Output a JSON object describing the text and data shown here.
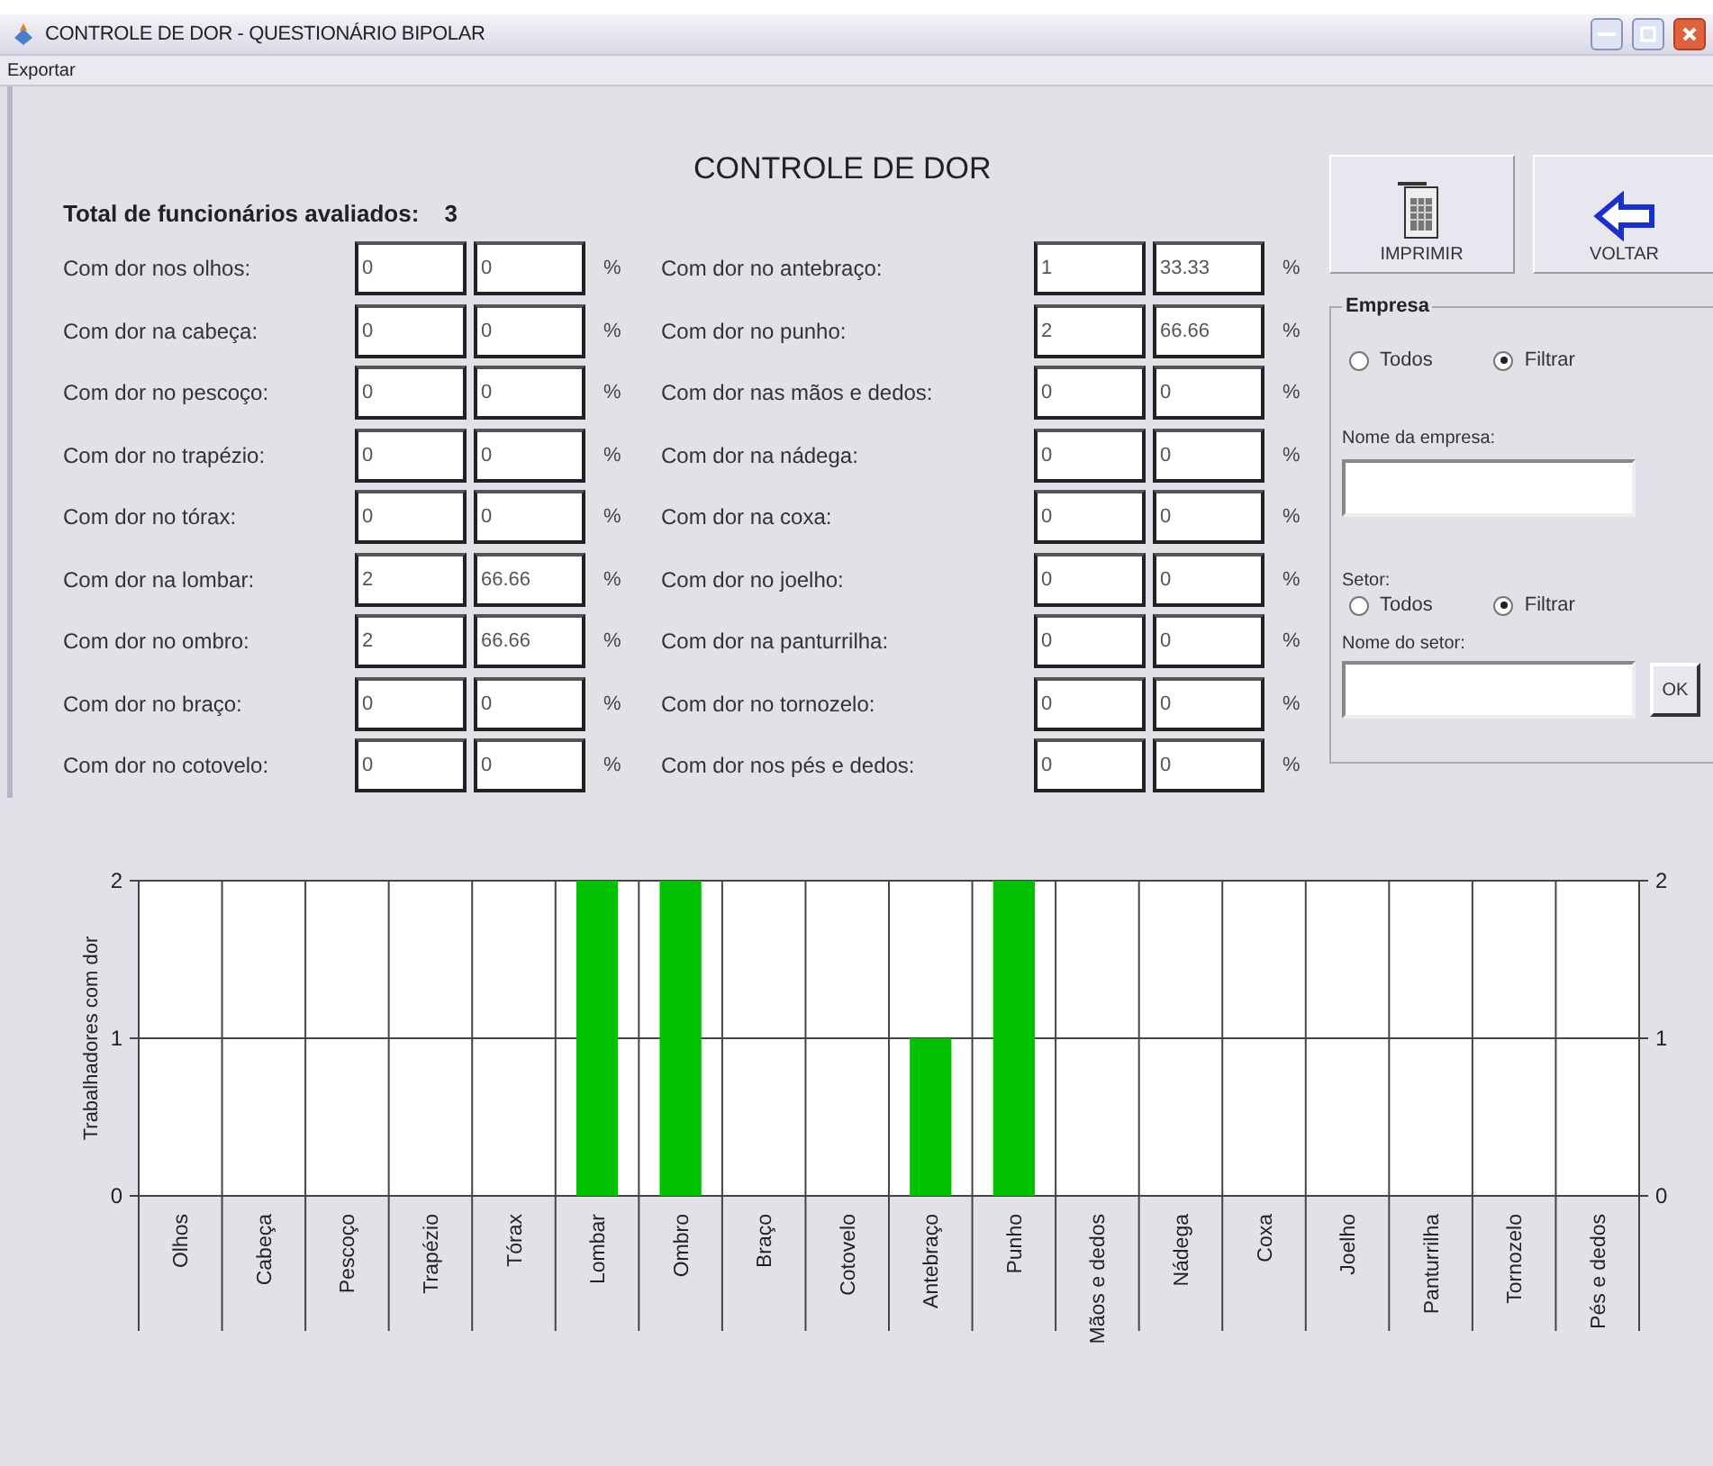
{
  "window": {
    "title": "CONTROLE DE DOR - QUESTIONÁRIO BIPOLAR"
  },
  "menu": [
    {
      "label": "Exportar"
    }
  ],
  "heading": "CONTROLE DE DOR",
  "total": {
    "label": "Total de funcionários avaliados:",
    "value": "3"
  },
  "field_columns": [
    {
      "rows": [
        {
          "label": "Com dor nos olhos:",
          "count": "0",
          "percent": "0",
          "unit": "%"
        },
        {
          "label": "Com dor na cabeça:",
          "count": "0",
          "percent": "0",
          "unit": "%"
        },
        {
          "label": "Com dor no pescoço:",
          "count": "0",
          "percent": "0",
          "unit": "%"
        },
        {
          "label": "Com dor no trapézio:",
          "count": "0",
          "percent": "0",
          "unit": "%"
        },
        {
          "label": "Com dor no tórax:",
          "count": "0",
          "percent": "0",
          "unit": "%"
        },
        {
          "label": "Com dor na lombar:",
          "count": "2",
          "percent": "66.66",
          "unit": "%"
        },
        {
          "label": "Com dor no ombro:",
          "count": "2",
          "percent": "66.66",
          "unit": "%"
        },
        {
          "label": "Com dor no braço:",
          "count": "0",
          "percent": "0",
          "unit": "%"
        },
        {
          "label": "Com dor no cotovelo:",
          "count": "0",
          "percent": "0",
          "unit": "%"
        }
      ]
    },
    {
      "rows": [
        {
          "label": "Com dor no antebraço:",
          "count": "1",
          "percent": "33.33",
          "unit": "%"
        },
        {
          "label": "Com dor no punho:",
          "count": "2",
          "percent": "66.66",
          "unit": "%"
        },
        {
          "label": "Com dor nas mãos e dedos:",
          "count": "0",
          "percent": "0",
          "unit": "%"
        },
        {
          "label": "Com dor na nádega:",
          "count": "0",
          "percent": "0",
          "unit": "%"
        },
        {
          "label": "Com dor na coxa:",
          "count": "0",
          "percent": "0",
          "unit": "%"
        },
        {
          "label": "Com dor no joelho:",
          "count": "0",
          "percent": "0",
          "unit": "%"
        },
        {
          "label": "Com dor na panturrilha:",
          "count": "0",
          "percent": "0",
          "unit": "%"
        },
        {
          "label": "Com dor no tornozelo:",
          "count": "0",
          "percent": "0",
          "unit": "%"
        },
        {
          "label": "Com dor nos pés e dedos:",
          "count": "0",
          "percent": "0",
          "unit": "%"
        }
      ]
    }
  ],
  "buttons": [
    {
      "label": "IMPRIMIR",
      "kind": "print"
    },
    {
      "label": "VOLTAR",
      "kind": "back"
    }
  ],
  "filter": {
    "title": "Empresa",
    "empresa": {
      "options": [
        {
          "label": "Todos",
          "selected": false
        },
        {
          "label": "Filtrar",
          "selected": true
        }
      ],
      "name_label": "Nome da empresa:"
    },
    "setor": {
      "title": "Setor:",
      "options": [
        {
          "label": "Todos",
          "selected": false
        },
        {
          "label": "Filtrar",
          "selected": true
        }
      ],
      "name_label": "Nome do setor:"
    },
    "ok_button": "OK"
  },
  "chart": {
    "chart_data": {
      "type": "bar",
      "ylabel": "Trabalhadores com dor",
      "categories": [
        "Olhos",
        "Cabeça",
        "Pescoço",
        "Trapézio",
        "Tórax",
        "Lombar",
        "Ombro",
        "Braço",
        "Cotovelo",
        "Antebraço",
        "Punho",
        "Mãos e dedos",
        "Nádega",
        "Coxa",
        "Joelho",
        "Panturrilha",
        "Tornozelo",
        "Pés e dedos"
      ],
      "series": [
        {
          "color": "#00c000",
          "values": [
            0,
            0,
            0,
            0,
            0,
            2,
            2,
            0,
            0,
            1,
            2,
            0,
            0,
            0,
            0,
            0,
            0,
            0
          ]
        }
      ],
      "ylim": [
        0,
        2
      ],
      "yticks": [
        0,
        1,
        2
      ]
    },
    "left_axis_labels": [
      "2",
      "1",
      "0"
    ],
    "right_axis_labels": [
      "2",
      "1",
      "0"
    ]
  }
}
